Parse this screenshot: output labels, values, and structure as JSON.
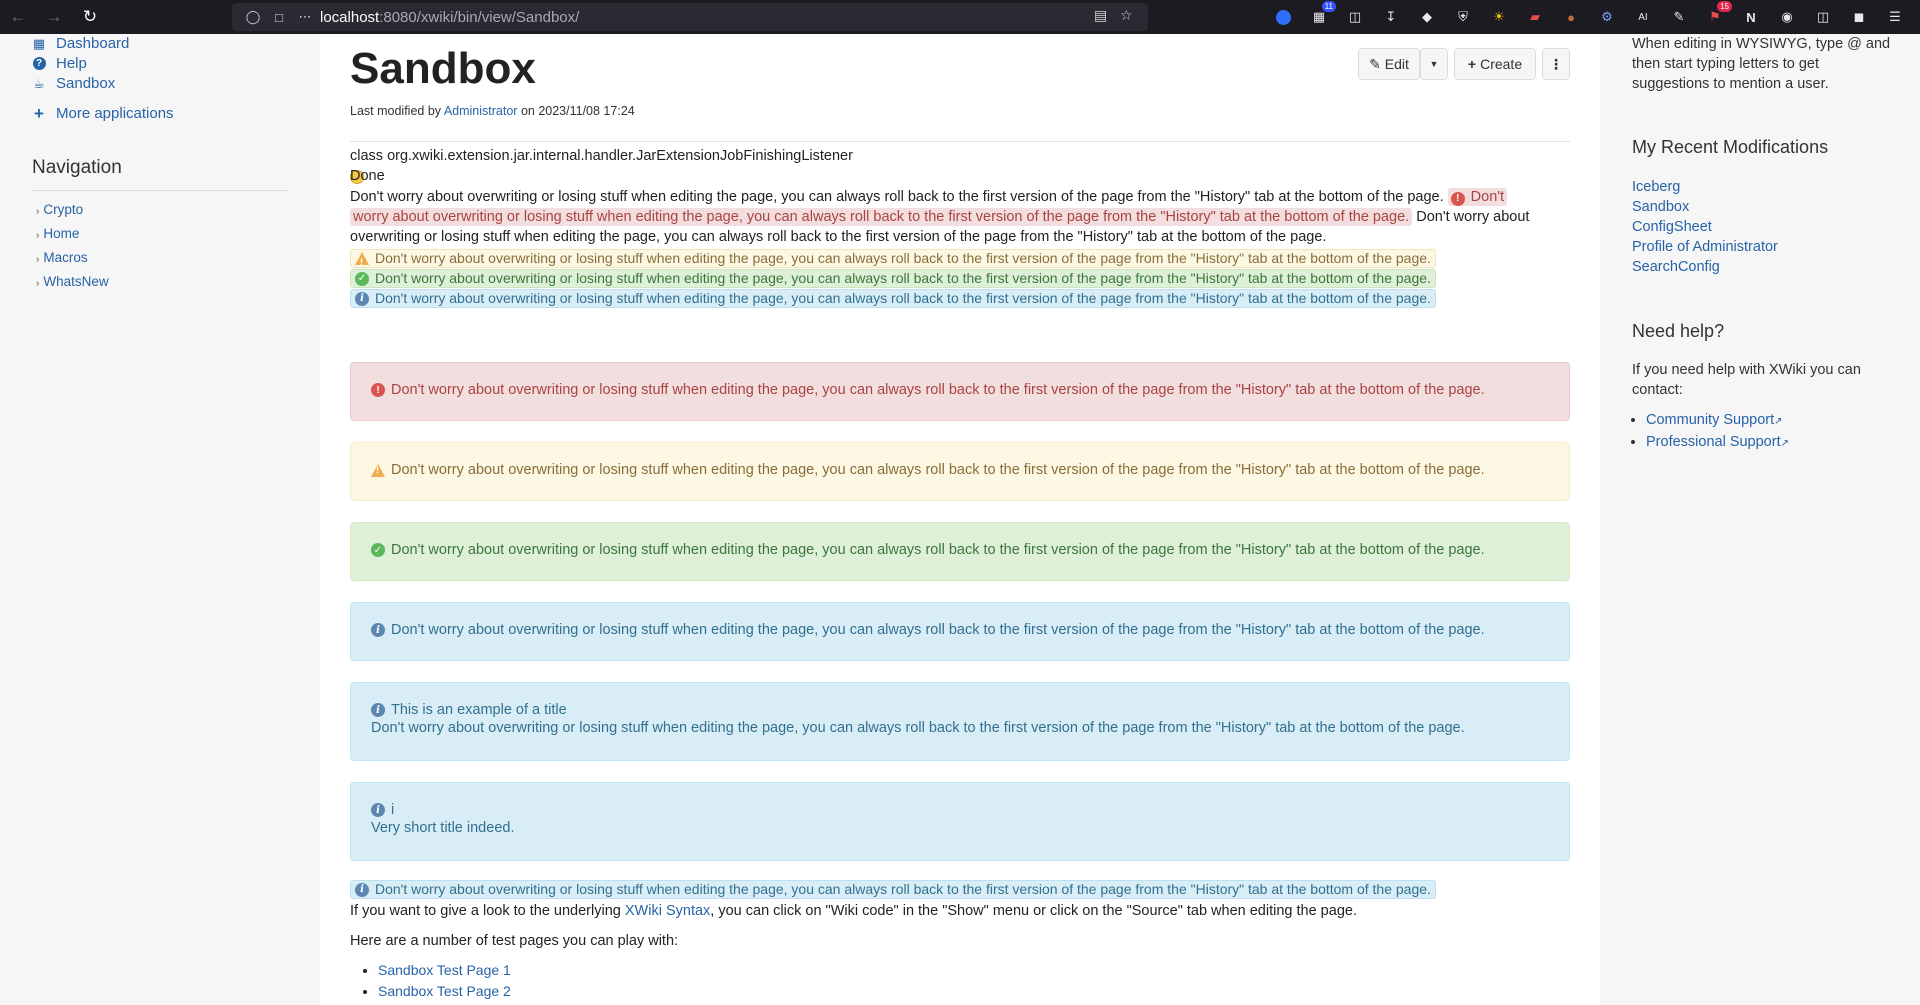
{
  "browser": {
    "url_host": "localhost",
    "url_rest": ":8080/xwiki/bin/view/Sandbox/",
    "extension_badges": [
      "11",
      "15"
    ]
  },
  "left": {
    "apps": [
      {
        "label": "Dashboard",
        "icon": "dashboard-icon"
      },
      {
        "label": "Help",
        "icon": "help-icon"
      },
      {
        "label": "Sandbox",
        "icon": "sandbox-icon"
      }
    ],
    "more_apps": "More applications",
    "navigation_heading": "Navigation",
    "nav_items": [
      "Crypto",
      "Home",
      "Macros",
      "WhatsNew"
    ]
  },
  "main": {
    "title": "Sandbox",
    "meta_prefix": "Last modified by",
    "meta_author": "Administrator",
    "meta_suffix": "on 2023/11/08 17:24",
    "edit_label": "Edit",
    "create_label": "Create",
    "class_line": "class org.xwiki.extension.jar.internal.handler.JarExtensionJobFinishingListener",
    "done_line": "Done",
    "para_prefix": "Don't worry about overwriting or losing stuff when editing the page, you can always roll back to the first version of the page from the \"History\" tab at the bottom of the page.",
    "para_err_1": "Don't",
    "para_err_2": "worry about overwriting or losing stuff when editing the page, you can always roll back to the first version of the page from the \"History\" tab at the bottom of the page.",
    "para_after_1": "Don't worry about",
    "para_after_2": "overwriting or losing stuff when editing the page, you can always roll back to the first version of the page from the \"History\" tab at the bottom of the page.",
    "message": "Don't worry about overwriting or losing stuff when editing the page, you can always roll back to the first version of the page from the \"History\" tab at the bottom of the page.",
    "box_title_1": "This is an example of a title",
    "box_title_2": "i",
    "box_short_text": "Very short title indeed.",
    "syntax_prefix": "If you want to give a look to the underlying",
    "syntax_link": "XWiki Syntax",
    "syntax_suffix": ", you can click on \"Wiki code\" in the \"Show\" menu or click on the \"Source\" tab when editing the page.",
    "test_pages_intro": "Here are a number of test pages you can play with:",
    "test_pages": [
      "Sandbox Test Page 1",
      "Sandbox Test Page 2"
    ]
  },
  "right": {
    "wysiwyg_tip": "When editing in WYSIWYG, type @ and then start typing letters to get suggestions to mention a user.",
    "recent_heading": "My Recent Modifications",
    "recent": [
      "Iceberg",
      "Sandbox",
      "ConfigSheet",
      "Profile of Administrator",
      "SearchConfig"
    ],
    "help_heading": "Need help?",
    "help_text": "If you need help with XWiki you can contact:",
    "help_links": [
      "Community Support",
      "Professional Support"
    ]
  },
  "colors": {
    "link": "#2763a7",
    "error": "#a94442",
    "warning": "#8a6d3b",
    "success": "#3c763d",
    "info": "#31708f"
  }
}
